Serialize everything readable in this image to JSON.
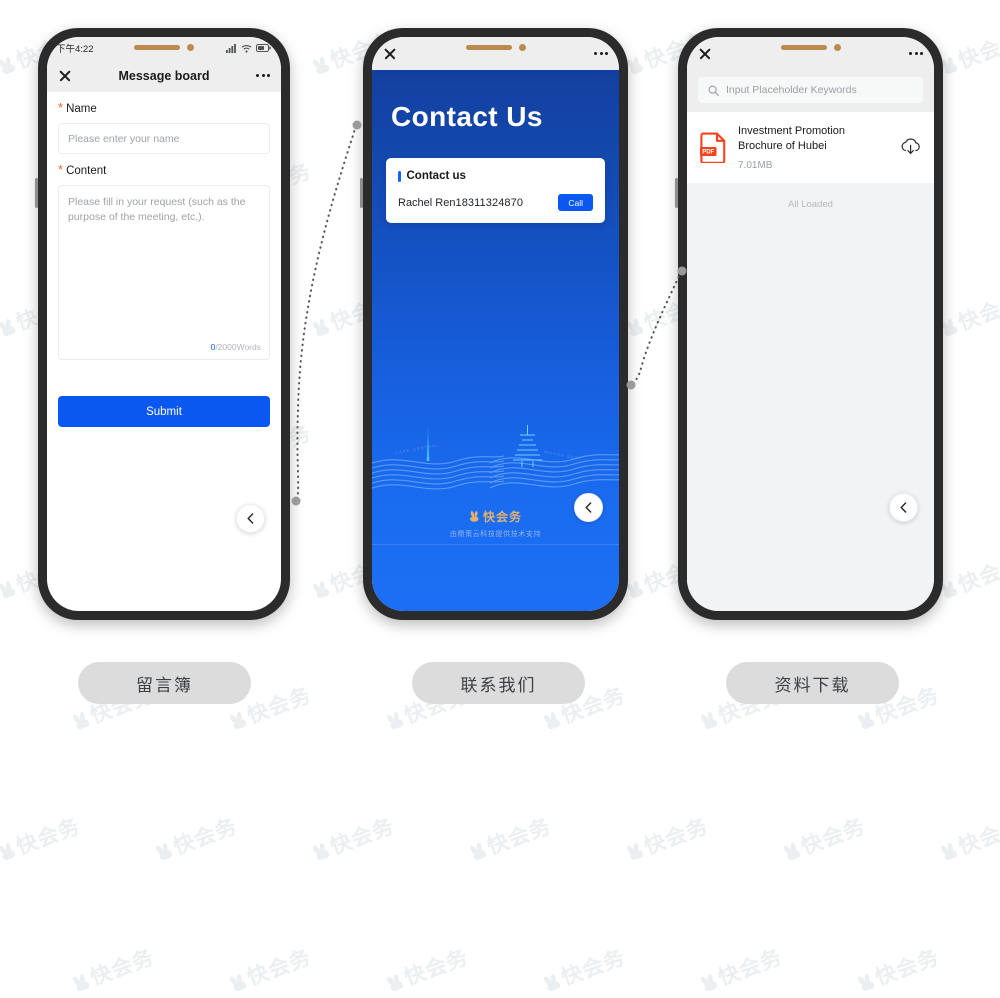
{
  "watermark": {
    "text": "快会务"
  },
  "phone1": {
    "status": {
      "time": "下午4:22",
      "signal": "signal-icon",
      "wifi": "wifi-icon",
      "battery": "battery-icon"
    },
    "nav": {
      "close": "close-icon",
      "title": "Message board",
      "more": "more-icon"
    },
    "form": {
      "name_label": "Name",
      "name_placeholder": "Please enter your name",
      "content_label": "Content",
      "content_placeholder": "Please fill in your request (such as the purpose of the meeting, etc.).",
      "counter_current": "0",
      "counter_rest": "/2000Words",
      "submit_label": "Submit",
      "required_mark": "*"
    },
    "back_button": "back-chevron"
  },
  "phone2": {
    "nav": {
      "close": "close-icon",
      "title": "",
      "more": "more-icon"
    },
    "hero_title": "Contact Us",
    "card": {
      "title": "Contact us",
      "contact_name": "Rachel Ren",
      "contact_phone": "18311324870",
      "call_label": "Call"
    },
    "footer": {
      "brand": "快会务",
      "powered_by": "由鼎策云科技提供技术支持"
    },
    "back_button": "back-chevron"
  },
  "phone3": {
    "nav": {
      "close": "close-icon",
      "title": "",
      "more": "more-icon"
    },
    "search": {
      "placeholder": "Input Placeholder Keywords",
      "icon": "search-icon"
    },
    "files": [
      {
        "type": "PDF",
        "name": "Investment Promotion Brochure of Hubei",
        "size": "7.01MB",
        "action": "download-cloud-icon"
      }
    ],
    "list_end": "All Loaded",
    "back_button": "back-chevron"
  },
  "captions": [
    {
      "label": "留言簿"
    },
    {
      "label": "联系我们"
    },
    {
      "label": "资料下载"
    }
  ],
  "colors": {
    "accent_blue": "#0a58f0",
    "hero_gradient_top": "#13409f",
    "hero_gradient_bottom": "#1c6ff4",
    "pdf_red": "#f5431b",
    "required_orange": "#f5662c",
    "caption_pill": "#dcdcdc",
    "notch_gold": "#bb8a4f"
  }
}
